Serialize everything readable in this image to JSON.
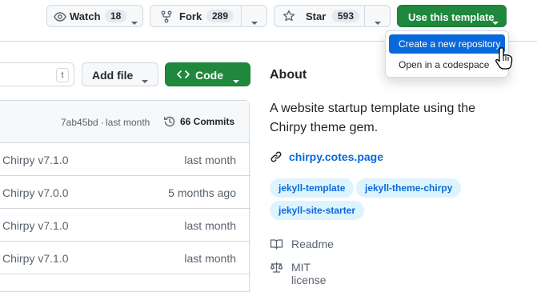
{
  "header": {
    "watch": {
      "label": "Watch",
      "count": "18"
    },
    "fork": {
      "label": "Fork",
      "count": "289"
    },
    "star": {
      "label": "Star",
      "count": "593"
    },
    "use_template_label": "Use this template"
  },
  "template_menu": {
    "items": [
      {
        "label": "Create a new repository",
        "selected": true
      },
      {
        "label": "Open in a codespace",
        "selected": false
      }
    ]
  },
  "file_toolbar": {
    "search_shortcut": "t",
    "add_file_label": "Add file",
    "code_label": "Code"
  },
  "commit_bar": {
    "hash": "7ab45bd",
    "separator": "·",
    "time": "last month",
    "commits_label": "66 Commits"
  },
  "file_rows": [
    {
      "message": "Chirpy v7.1.0",
      "time": "last month"
    },
    {
      "message": "Chirpy v7.0.0",
      "time": "5 months ago"
    },
    {
      "message": "Chirpy v7.1.0",
      "time": "last month"
    },
    {
      "message": "Chirpy v7.1.0",
      "time": "last month"
    }
  ],
  "about": {
    "heading": "About",
    "description": "A website startup template using the Chirpy theme gem.",
    "link": "chirpy.cotes.page",
    "topics": [
      "jekyll-template",
      "jekyll-theme-chirpy",
      "jekyll-site-starter"
    ],
    "readme_label": "Readme",
    "license_label": "MIT license"
  },
  "colors": {
    "accent_green": "#1f883d",
    "link_blue": "#0969da",
    "menu_selected": "#0969da",
    "topic_bg": "#ddf4ff"
  }
}
